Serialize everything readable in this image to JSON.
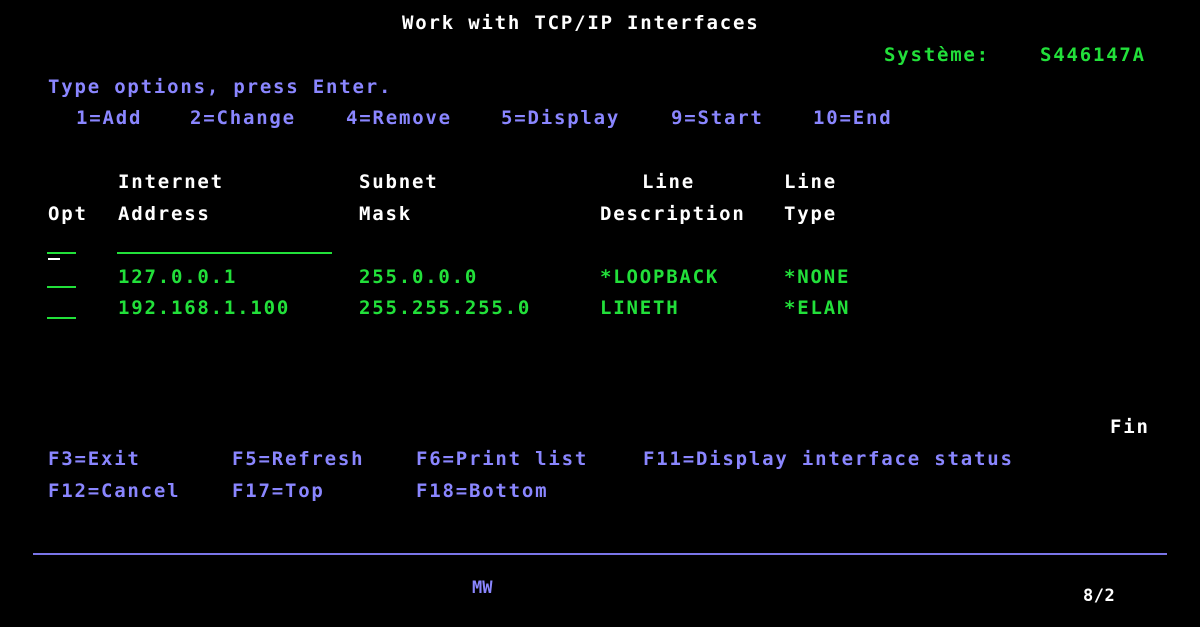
{
  "screen": {
    "title": "Work with TCP/IP Interfaces",
    "system_label": "Système:",
    "system_name": "S446147A",
    "instruction": "Type options, press Enter.",
    "options": [
      "1=Add",
      "2=Change",
      "4=Remove",
      "5=Display",
      "9=Start",
      "10=End"
    ],
    "columns": {
      "opt": "Opt",
      "internet_1": "Internet",
      "internet_2": "Address",
      "subnet_1": "Subnet",
      "subnet_2": "Mask",
      "line_desc_1": "Line",
      "line_desc_2": "Description",
      "line_type_1": "Line",
      "line_type_2": "Type"
    },
    "rows": [
      {
        "address": "127.0.0.1",
        "mask": "255.0.0.0",
        "line_description": "*LOOPBACK",
        "line_type": "*NONE"
      },
      {
        "address": "192.168.1.100",
        "mask": "255.255.255.0",
        "line_description": "LINETH",
        "line_type": "*ELAN"
      }
    ],
    "more_indicator": "Fin",
    "function_keys": [
      "F3=Exit",
      "F5=Refresh",
      "F6=Print list",
      "F11=Display interface status",
      "F12=Cancel",
      "F17=Top",
      "F18=Bottom"
    ],
    "status_bar": {
      "session": "MW",
      "cursor_position": "8/2"
    }
  },
  "colors": {
    "background": "#000000",
    "heading": "#ffffff",
    "data": "#22e03a",
    "prompt": "#8a86ff"
  }
}
